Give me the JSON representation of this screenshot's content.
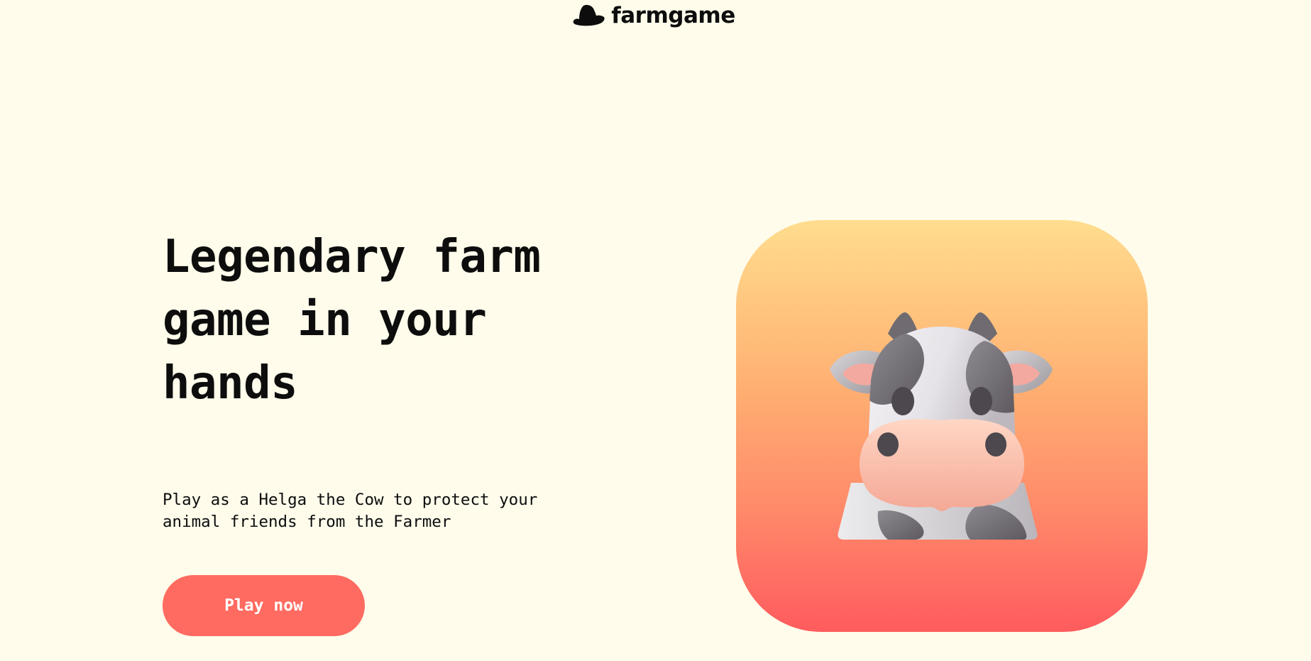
{
  "header": {
    "brand": "farmgame"
  },
  "hero": {
    "title": "Legendary farm game in your hands",
    "subtitle": "Play as a Helga the Cow to protect your animal friends from the Farmer",
    "cta_label": "Play now"
  },
  "icons": {
    "logo": "cowboy-hat-icon",
    "hero_image": "cow-face-icon"
  },
  "colors": {
    "background": "#fffceb",
    "accent": "#ff6b61",
    "gradient_top": "#ffdd8e",
    "gradient_bottom": "#ff5b5e"
  }
}
